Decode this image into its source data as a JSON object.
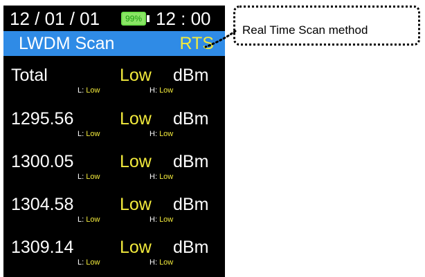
{
  "status_bar": {
    "date": "12 / 01 / 01",
    "battery_label": "99%",
    "battery_level": 0.99,
    "time": "12 : 00"
  },
  "title_bar": {
    "title": "LWDM Scan",
    "mode": "RTS"
  },
  "rows": [
    {
      "label": "Total",
      "value": "Low",
      "unit": "dBm",
      "low_key": "L:",
      "low_value": "Low",
      "high_key": "H:",
      "high_value": "Low"
    },
    {
      "label": "1295.56",
      "value": "Low",
      "unit": "dBm",
      "low_key": "L:",
      "low_value": "Low",
      "high_key": "H:",
      "high_value": "Low"
    },
    {
      "label": "1300.05",
      "value": "Low",
      "unit": "dBm",
      "low_key": "L:",
      "low_value": "Low",
      "high_key": "H:",
      "high_value": "Low"
    },
    {
      "label": "1304.58",
      "value": "Low",
      "unit": "dBm",
      "low_key": "L:",
      "low_value": "Low",
      "high_key": "H:",
      "high_value": "Low"
    },
    {
      "label": "1309.14",
      "value": "Low",
      "unit": "dBm",
      "low_key": "L:",
      "low_value": "Low",
      "high_key": "H:",
      "high_value": "Low"
    }
  ],
  "annotation": {
    "text": "Real Time Scan method"
  },
  "colors": {
    "screen_background": "#000000",
    "title_bar": "#2f8be6",
    "accent_yellow": "#f2ea3c",
    "battery_green": "#8be566"
  }
}
